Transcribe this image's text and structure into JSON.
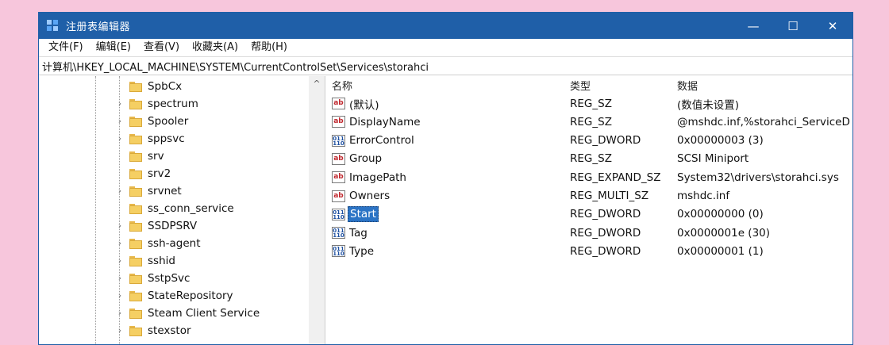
{
  "window": {
    "title": "注册表编辑器",
    "minimize_glyph": "—",
    "maximize_glyph": "☐",
    "close_glyph": "✕"
  },
  "menu": {
    "items": [
      "文件(F)",
      "编辑(E)",
      "查看(V)",
      "收藏夹(A)",
      "帮助(H)"
    ]
  },
  "address": {
    "path": "计算机\\HKEY_LOCAL_MACHINE\\SYSTEM\\CurrentControlSet\\Services\\storahci"
  },
  "tree": {
    "items": [
      {
        "label": "SpbCx",
        "expandable": false
      },
      {
        "label": "spectrum",
        "expandable": true
      },
      {
        "label": "Spooler",
        "expandable": true
      },
      {
        "label": "sppsvc",
        "expandable": true
      },
      {
        "label": "srv",
        "expandable": false
      },
      {
        "label": "srv2",
        "expandable": false
      },
      {
        "label": "srvnet",
        "expandable": true
      },
      {
        "label": "ss_conn_service",
        "expandable": false
      },
      {
        "label": "SSDPSRV",
        "expandable": true
      },
      {
        "label": "ssh-agent",
        "expandable": true
      },
      {
        "label": "sshid",
        "expandable": true
      },
      {
        "label": "SstpSvc",
        "expandable": true
      },
      {
        "label": "StateRepository",
        "expandable": true
      },
      {
        "label": "Steam Client Service",
        "expandable": true
      },
      {
        "label": "stexstor",
        "expandable": true
      }
    ],
    "scroll_up_glyph": "^"
  },
  "values": {
    "headers": {
      "name": "名称",
      "type": "类型",
      "data": "数据"
    },
    "rows": [
      {
        "name": "(默认)",
        "type": "REG_SZ",
        "data": "(数值未设置)",
        "icon": "string-value-icon",
        "selected": false
      },
      {
        "name": "DisplayName",
        "type": "REG_SZ",
        "data": "@mshdc.inf,%storahci_ServiceD",
        "icon": "string-value-icon",
        "selected": false
      },
      {
        "name": "ErrorControl",
        "type": "REG_DWORD",
        "data": "0x00000003 (3)",
        "icon": "binary-value-icon",
        "selected": false
      },
      {
        "name": "Group",
        "type": "REG_SZ",
        "data": "SCSI Miniport",
        "icon": "string-value-icon",
        "selected": false
      },
      {
        "name": "ImagePath",
        "type": "REG_EXPAND_SZ",
        "data": "System32\\drivers\\storahci.sys",
        "icon": "string-value-icon",
        "selected": false
      },
      {
        "name": "Owners",
        "type": "REG_MULTI_SZ",
        "data": "mshdc.inf",
        "icon": "string-value-icon",
        "selected": false
      },
      {
        "name": "Start",
        "type": "REG_DWORD",
        "data": "0x00000000 (0)",
        "icon": "binary-value-icon",
        "selected": true
      },
      {
        "name": "Tag",
        "type": "REG_DWORD",
        "data": "0x0000001e (30)",
        "icon": "binary-value-icon",
        "selected": false
      },
      {
        "name": "Type",
        "type": "REG_DWORD",
        "data": "0x00000001 (1)",
        "icon": "binary-value-icon",
        "selected": false
      }
    ]
  },
  "colors": {
    "background": "#f7c6dc",
    "titlebar": "#1f5fa8",
    "selection": "#2b73c5"
  }
}
